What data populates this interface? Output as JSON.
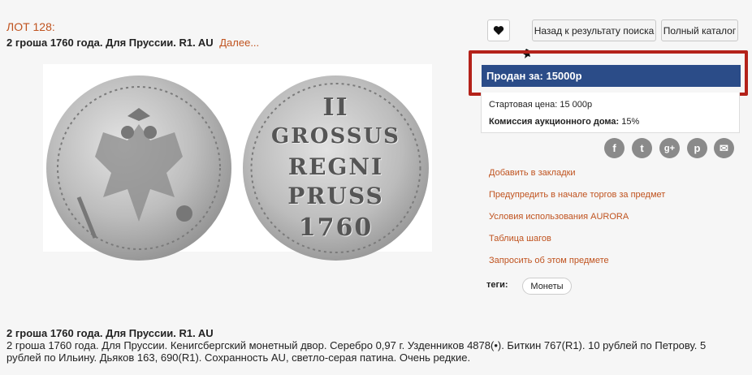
{
  "lot": {
    "number_label": "ЛОТ 128:",
    "title": "2 гроша 1760 года. Для Пруссии. R1. AU",
    "more_link": "Далее..."
  },
  "coin": {
    "reverse_lines": [
      "II",
      "GROSSUS",
      "REGNI",
      "PRUSS",
      "1760"
    ]
  },
  "toolbar": {
    "favorite_icon": "heart-icon",
    "back_label": "Назад к результату поиска",
    "catalog_label": "Полный каталог",
    "pin_icon": "pin-icon"
  },
  "sale": {
    "sold_label": "Продан за: 15000р",
    "start_price_label": "Стартовая цена:",
    "start_price_value": "15 000р",
    "commission_label": "Комиссия аукционного дома:",
    "commission_value": "15%"
  },
  "share": {
    "icons": [
      "facebook-icon",
      "twitter-icon",
      "googleplus-icon",
      "pinterest-icon",
      "email-icon"
    ],
    "glyphs": [
      "f",
      "t",
      "g+",
      "p",
      "✉"
    ]
  },
  "actions": [
    "Добавить в закладки",
    "Предупредить в начале торгов за предмет",
    "Условия использования AURORA",
    "Таблица шагов",
    "Запросить об этом предмете"
  ],
  "tags": {
    "label": "теги:",
    "items": [
      "Монеты"
    ]
  },
  "description": {
    "title": "2 гроша 1760 года. Для Пруссии. R1. AU",
    "text": "2 гроша 1760 года. Для Пруссии. Кенигсбергский монетный двор. Серебро 0,97 г. Узденников 4878(•). Биткин 767(R1). 10 рублей по Петрову. 5 рублей по Ильину. Дьяков 163, 690(R1). Сохранность AU, светло-серая патина. Очень редкие."
  },
  "colors": {
    "accent": "#c0531f",
    "sold_bg": "#2b4c88",
    "highlight": "#b4221a",
    "share_icon": "#8a8a8a"
  }
}
